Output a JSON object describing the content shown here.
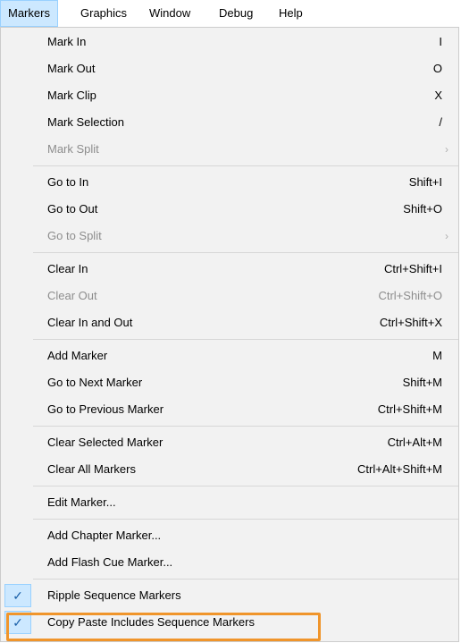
{
  "menubar": {
    "items": [
      {
        "label": "Markers"
      },
      {
        "label": "Graphics"
      },
      {
        "label": "Window"
      },
      {
        "label": "Debug"
      },
      {
        "label": "Help"
      }
    ]
  },
  "menu": {
    "groups": [
      [
        {
          "label": "Mark In",
          "shortcut": "I"
        },
        {
          "label": "Mark Out",
          "shortcut": "O"
        },
        {
          "label": "Mark Clip",
          "shortcut": "X"
        },
        {
          "label": "Mark Selection",
          "shortcut": "/"
        },
        {
          "label": "Mark Split",
          "shortcut": "",
          "disabled": true,
          "submenu": true
        }
      ],
      [
        {
          "label": "Go to In",
          "shortcut": "Shift+I"
        },
        {
          "label": "Go to Out",
          "shortcut": "Shift+O"
        },
        {
          "label": "Go to Split",
          "shortcut": "",
          "disabled": true,
          "submenu": true
        }
      ],
      [
        {
          "label": "Clear In",
          "shortcut": "Ctrl+Shift+I"
        },
        {
          "label": "Clear Out",
          "shortcut": "Ctrl+Shift+O",
          "disabled": true
        },
        {
          "label": "Clear In and Out",
          "shortcut": "Ctrl+Shift+X"
        }
      ],
      [
        {
          "label": "Add Marker",
          "shortcut": "M"
        },
        {
          "label": "Go to Next Marker",
          "shortcut": "Shift+M"
        },
        {
          "label": "Go to Previous Marker",
          "shortcut": "Ctrl+Shift+M"
        }
      ],
      [
        {
          "label": "Clear Selected Marker",
          "shortcut": "Ctrl+Alt+M"
        },
        {
          "label": "Clear All Markers",
          "shortcut": "Ctrl+Alt+Shift+M"
        }
      ],
      [
        {
          "label": "Edit Marker...",
          "shortcut": ""
        }
      ],
      [
        {
          "label": "Add Chapter Marker...",
          "shortcut": ""
        },
        {
          "label": "Add Flash Cue Marker...",
          "shortcut": ""
        }
      ],
      [
        {
          "label": "Ripple Sequence Markers",
          "shortcut": "",
          "checked": true
        },
        {
          "label": "Copy Paste Includes Sequence Markers",
          "shortcut": "",
          "checked": true,
          "highlighted": true
        }
      ]
    ]
  },
  "icons": {
    "check": "check-icon",
    "submenu": "chevron-right-icon"
  },
  "colors": {
    "active_bg": "#cce8ff",
    "active_border": "#99d1ff",
    "menu_bg": "#f2f2f2",
    "disabled_text": "#8d8d8d",
    "highlight_outline": "#f0952b"
  }
}
